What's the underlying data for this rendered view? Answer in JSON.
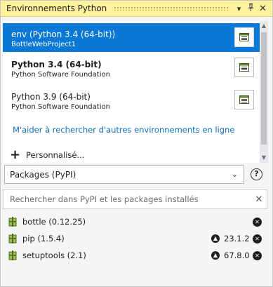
{
  "window": {
    "title": "Environnements Python",
    "controls": [
      "dropdown-icon",
      "pin-icon",
      "close-icon"
    ]
  },
  "environments": [
    {
      "name": "env (Python 3.4 (64-bit))",
      "subtitle": "BottleWebProject1",
      "selected": true,
      "bold": false
    },
    {
      "name": "Python 3.4 (64-bit)",
      "subtitle": "Python Software Foundation",
      "selected": false,
      "bold": true
    },
    {
      "name": "Python 3.9 (64-bit)",
      "subtitle": "Python Software Foundation",
      "selected": false,
      "bold": false
    }
  ],
  "env_help_link": "M'aider à rechercher d'autres environnements en ligne",
  "custom_label": "Personnalisé...",
  "view_select": {
    "value": "Packages (PyPI)"
  },
  "help_label": "?",
  "search": {
    "placeholder": "Rechercher dans PyPI et les packages installés",
    "value": ""
  },
  "packages": [
    {
      "name": "bottle (0.12.25)",
      "update": ""
    },
    {
      "name": "pip (1.5.4)",
      "update": "23.1.2"
    },
    {
      "name": "setuptools (2.1)",
      "update": "67.8.0"
    }
  ],
  "colors": {
    "titlebar": "#fff29d",
    "selection": "#0a78d7",
    "link": "#0e70c0"
  }
}
